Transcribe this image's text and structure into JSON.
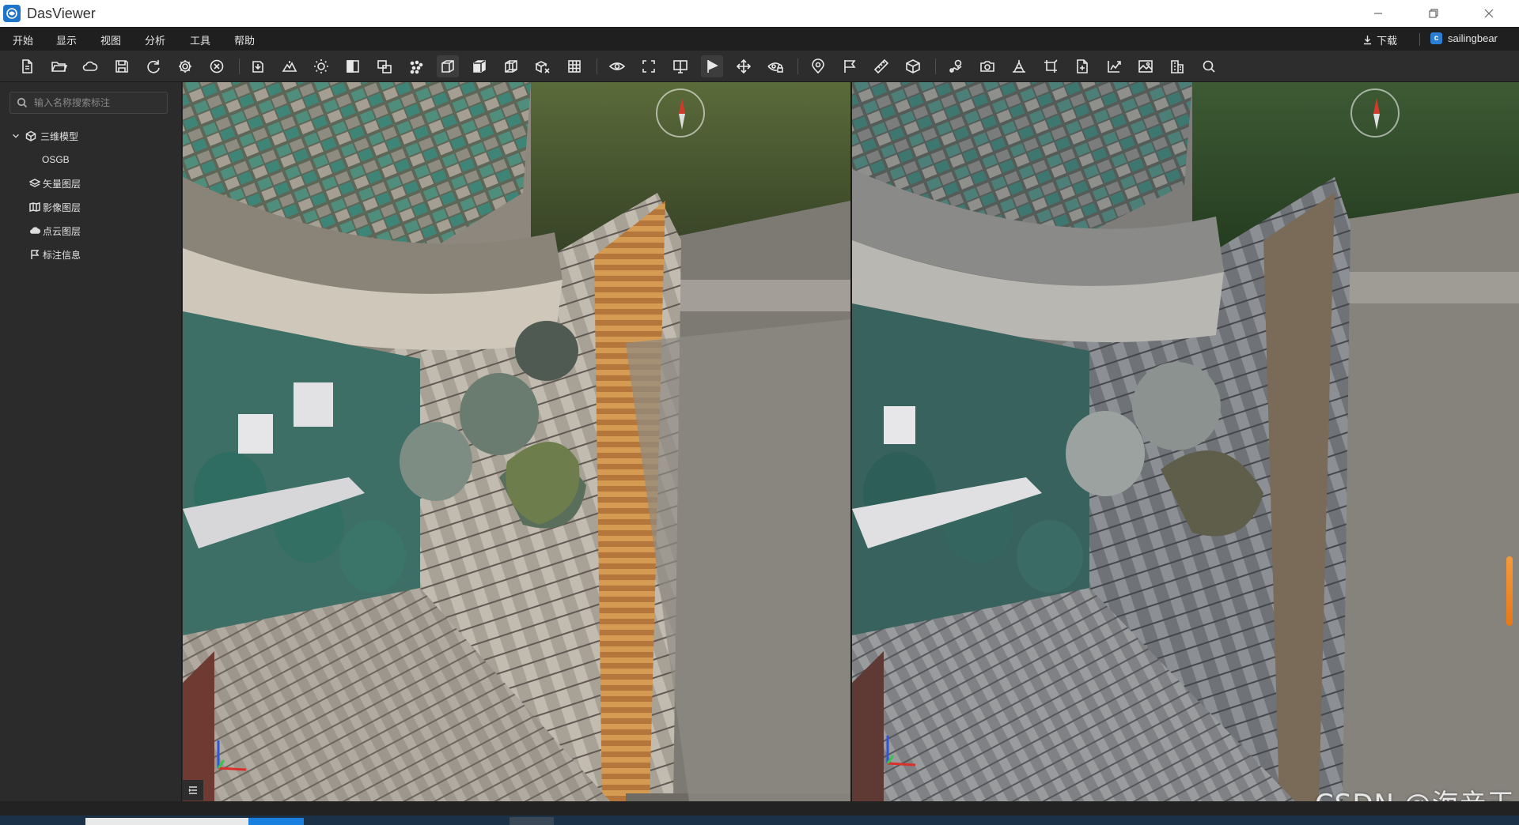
{
  "app": {
    "title": "DasViewer",
    "window_controls": [
      "minimize-icon",
      "restore-icon",
      "close-icon"
    ]
  },
  "menubar": {
    "items": [
      "开始",
      "显示",
      "视图",
      "分析",
      "工具",
      "帮助"
    ],
    "download_label": "下载",
    "user_name": "sailingbear",
    "user_logo_letter": "c"
  },
  "toolbar": {
    "icons": [
      "new-file-icon",
      "open-folder-icon",
      "cloud-icon",
      "save-icon",
      "refresh-icon",
      "settings-icon",
      "close-circle-icon",
      "import-model-icon",
      "terrain-icon",
      "lighting-icon",
      "half-pane-icon",
      "overlay-icon",
      "points-icon",
      "cube-front-icon",
      "cube-solid-icon",
      "cube-wire-icon",
      "cube-clip-icon",
      "grid-icon",
      "eye-rotate-icon",
      "fullscreen-icon",
      "split-view-icon",
      "flag-mark-icon",
      "move-icon",
      "eye-lock-icon",
      "location-pin-icon",
      "flag-icon",
      "ruler-icon",
      "box-measure-icon",
      "route-icon",
      "camera-icon",
      "volume-icon",
      "crop-icon",
      "export-icon",
      "chart-export-icon",
      "image-icon",
      "building-icon",
      "search-icon"
    ]
  },
  "sidebar": {
    "search_placeholder": "输入名称搜索标注",
    "tree": {
      "root_label": "三维模型",
      "child_label": "OSGB",
      "layers": [
        "矢量图层",
        "影像图层",
        "点云图层",
        "标注信息"
      ]
    }
  },
  "colors": {
    "titlebar": "#ffffff",
    "menubar": "#1f1f1f",
    "toolbar": "#2d2d2d",
    "sidebar": "#2b2b2b",
    "accent": "#1e74c8",
    "scroll_indicator": "#f08a2a"
  },
  "watermark": "CSDN @海亲王"
}
